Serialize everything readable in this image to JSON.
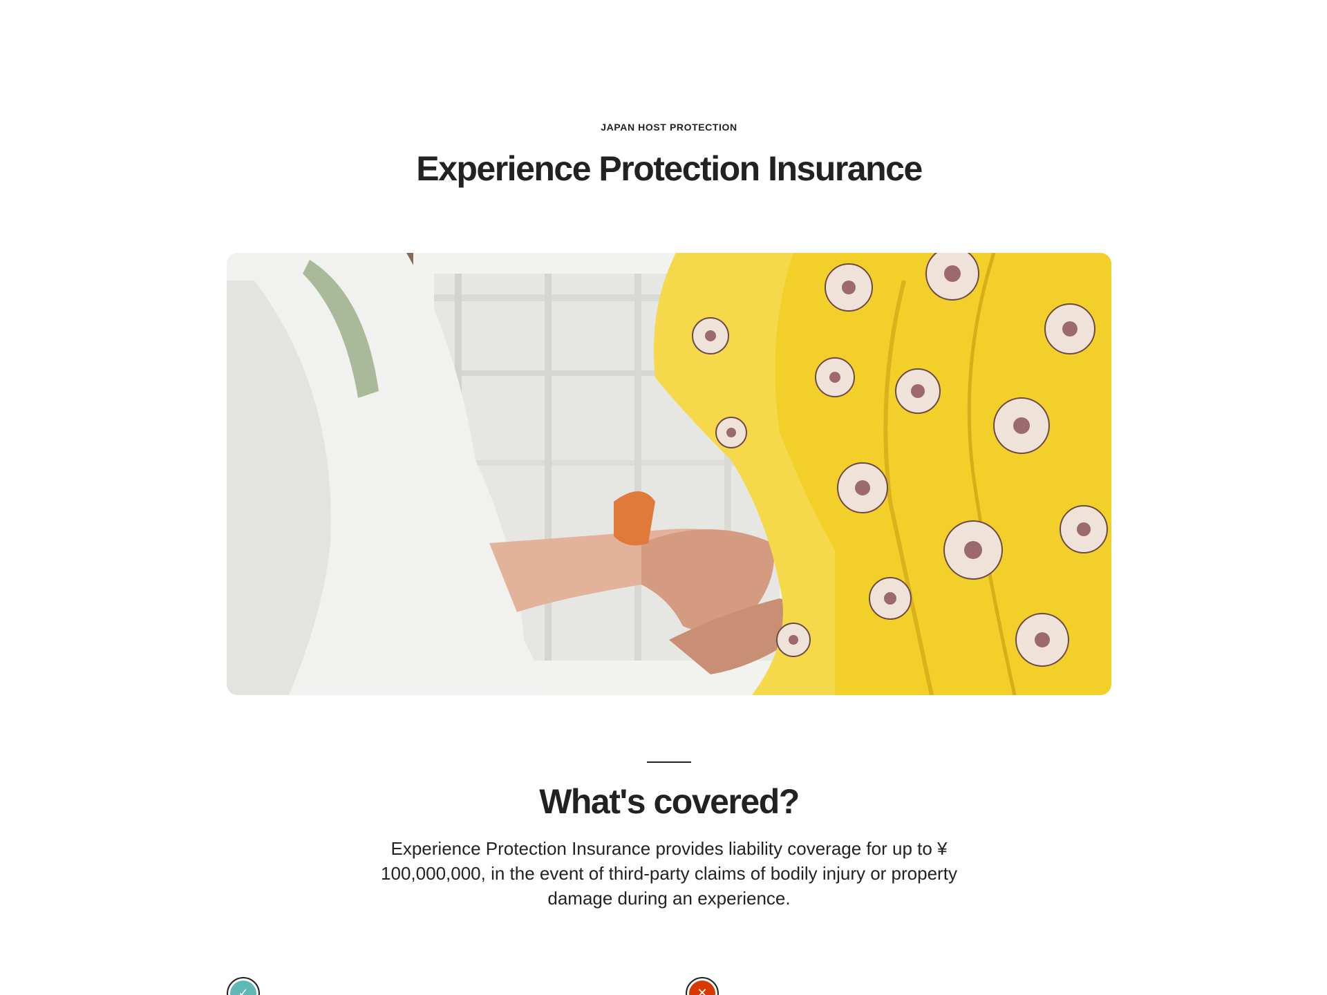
{
  "header": {
    "eyebrow": "JAPAN HOST PROTECTION",
    "title": "Experience Protection Insurance"
  },
  "hero_image": {
    "alt": "Hands adjusting a yellow floral kimono",
    "palette": {
      "background": "#f3f3f1",
      "fabric": "#f3cf2a",
      "flower": "#efe2d8",
      "flower_center": "#9c6a6e",
      "skin": "#d9a68b",
      "shirt": "#f4f4f2"
    }
  },
  "coverage": {
    "title": "What's covered?",
    "description": "Experience Protection Insurance provides liability coverage for up to ¥ 100,000,000, in the event of third-party claims of bodily injury or property damage during an experience."
  },
  "status_icons": {
    "covered": {
      "icon": "check-icon",
      "glyph": "✓",
      "color": "#5fb8b3"
    },
    "not_covered": {
      "icon": "close-icon",
      "glyph": "✕",
      "color": "#d93900"
    }
  }
}
